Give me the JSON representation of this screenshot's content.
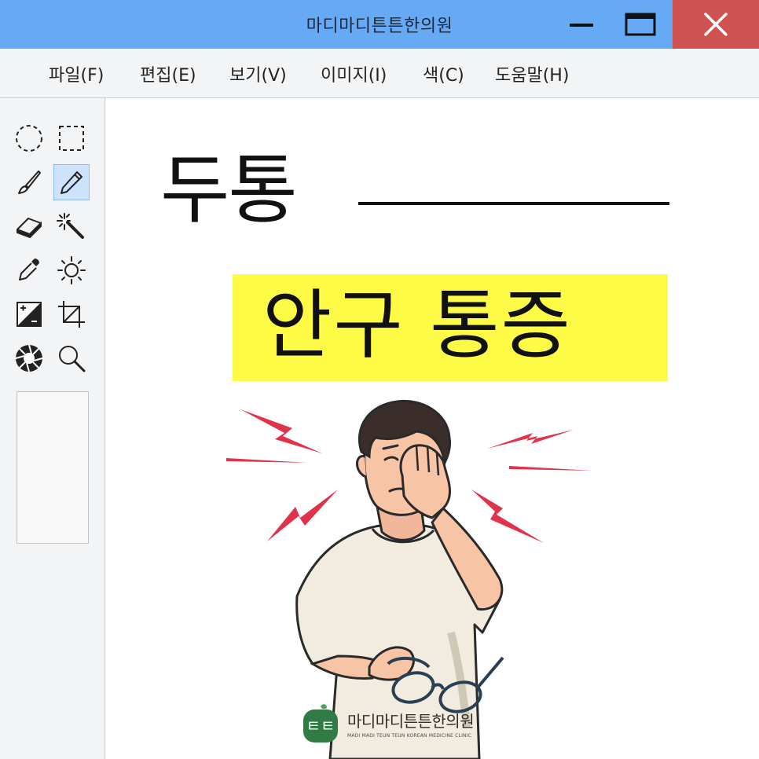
{
  "window": {
    "title": "마디마디튼튼한의원",
    "minimize_icon": "minimize-icon",
    "maximize_icon": "maximize-icon",
    "close_icon": "close-icon",
    "close_color": "#cf5252",
    "titlebar_color": "#66aaf5"
  },
  "menu": {
    "items": [
      "파일(F)",
      "편집(E)",
      "보기(V)",
      "이미지(I)",
      "색(C)",
      "도움말(H)"
    ]
  },
  "toolbox": {
    "tools": [
      {
        "icon": "ellipse-select-icon"
      },
      {
        "icon": "rect-select-icon"
      },
      {
        "icon": "brush-icon"
      },
      {
        "icon": "pencil-icon",
        "selected": true
      },
      {
        "icon": "eraser-icon"
      },
      {
        "icon": "magic-wand-icon"
      },
      {
        "icon": "eyedropper-icon"
      },
      {
        "icon": "brightness-icon"
      },
      {
        "icon": "contrast-icon"
      },
      {
        "icon": "crop-icon"
      },
      {
        "icon": "aperture-icon"
      },
      {
        "icon": "zoom-icon"
      }
    ],
    "selected_color": "#cde3fb"
  },
  "canvas": {
    "heading": "두통",
    "highlight_text": "안구 통증",
    "highlight_color": "#fdfb46",
    "accent_color": "#e0324b",
    "logo": {
      "mark": "ㅌㅌ",
      "name": "마디마디튼튼한의원",
      "subtitle": "MADI MADI TEUN TEUN KOREAN MEDICINE CLINIC"
    }
  }
}
